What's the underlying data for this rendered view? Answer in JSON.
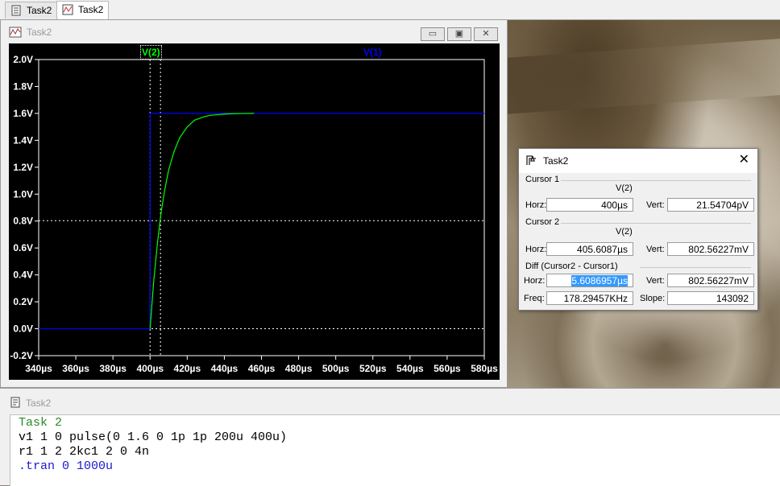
{
  "tabs": [
    {
      "label": "Task2",
      "icon": "schematic-icon",
      "active": false
    },
    {
      "label": "Task2",
      "icon": "waveform-icon",
      "active": true
    }
  ],
  "plot_window": {
    "title": "Task2",
    "trace_labels": {
      "v2": "V(2)",
      "v1": "V(1)"
    },
    "colors": {
      "v2": "#00ff00",
      "v1": "#0000ff",
      "background": "#000000"
    }
  },
  "chart_data": {
    "type": "line",
    "title": "",
    "xlabel": "",
    "ylabel": "",
    "xlim": [
      340,
      580
    ],
    "ylim": [
      -0.2,
      2.0
    ],
    "x_unit": "µs",
    "y_unit": "V",
    "xticks": [
      "340µs",
      "360µs",
      "380µs",
      "400µs",
      "420µs",
      "440µs",
      "460µs",
      "480µs",
      "500µs",
      "520µs",
      "540µs",
      "560µs",
      "580µs"
    ],
    "yticks": [
      "2.0V",
      "1.8V",
      "1.6V",
      "1.4V",
      "1.2V",
      "1.0V",
      "0.8V",
      "0.6V",
      "0.4V",
      "0.2V",
      "0.0V",
      "-0.2V"
    ],
    "series": [
      {
        "name": "V(1)",
        "x": [
          340,
          400,
          400,
          580
        ],
        "y": [
          0.0,
          0.0,
          1.6,
          1.6
        ]
      },
      {
        "name": "V(2)",
        "x": [
          400,
          402,
          404,
          406,
          408,
          410,
          413,
          416,
          420,
          424,
          428,
          432,
          436,
          440,
          445,
          450,
          456
        ],
        "y": [
          0.0,
          0.36,
          0.64,
          0.87,
          1.04,
          1.18,
          1.32,
          1.42,
          1.5,
          1.55,
          1.57,
          1.585,
          1.59,
          1.595,
          1.598,
          1.599,
          1.6
        ]
      }
    ],
    "cursors": {
      "cursor1_x": 400,
      "cursor2_x": 405.6087,
      "cursor2_y": 0.80256
    }
  },
  "cursor_dialog": {
    "title": "Task2",
    "cursor1": {
      "group": "Cursor 1",
      "trace": "V(2)",
      "horz_label": "Horz:",
      "horz": "400µs",
      "vert_label": "Vert:",
      "vert": "21.54704pV"
    },
    "cursor2": {
      "group": "Cursor 2",
      "trace": "V(2)",
      "horz_label": "Horz:",
      "horz": "405.6087µs",
      "vert_label": "Vert:",
      "vert": "802.56227mV"
    },
    "diff": {
      "group": "Diff (Cursor2 - Cursor1)",
      "horz_label": "Horz:",
      "horz": "5.6086957µs",
      "vert_label": "Vert:",
      "vert": "802.56227mV",
      "freq_label": "Freq:",
      "freq": "178.29457KHz",
      "slope_label": "Slope:",
      "slope": "143092"
    }
  },
  "netlist": {
    "title": "Task2",
    "lines": [
      {
        "text": "Task 2",
        "color": "#2a8a2a"
      },
      {
        "text": "v1 1 0 pulse(0 1.6 0 1p 1p 200u 400u)",
        "color": "#000000"
      },
      {
        "text": "r1 1 2 2kc1 2 0 4n",
        "color": "#000000"
      },
      {
        "text": ".tran 0 1000u",
        "color": "#1a1acc"
      }
    ]
  }
}
